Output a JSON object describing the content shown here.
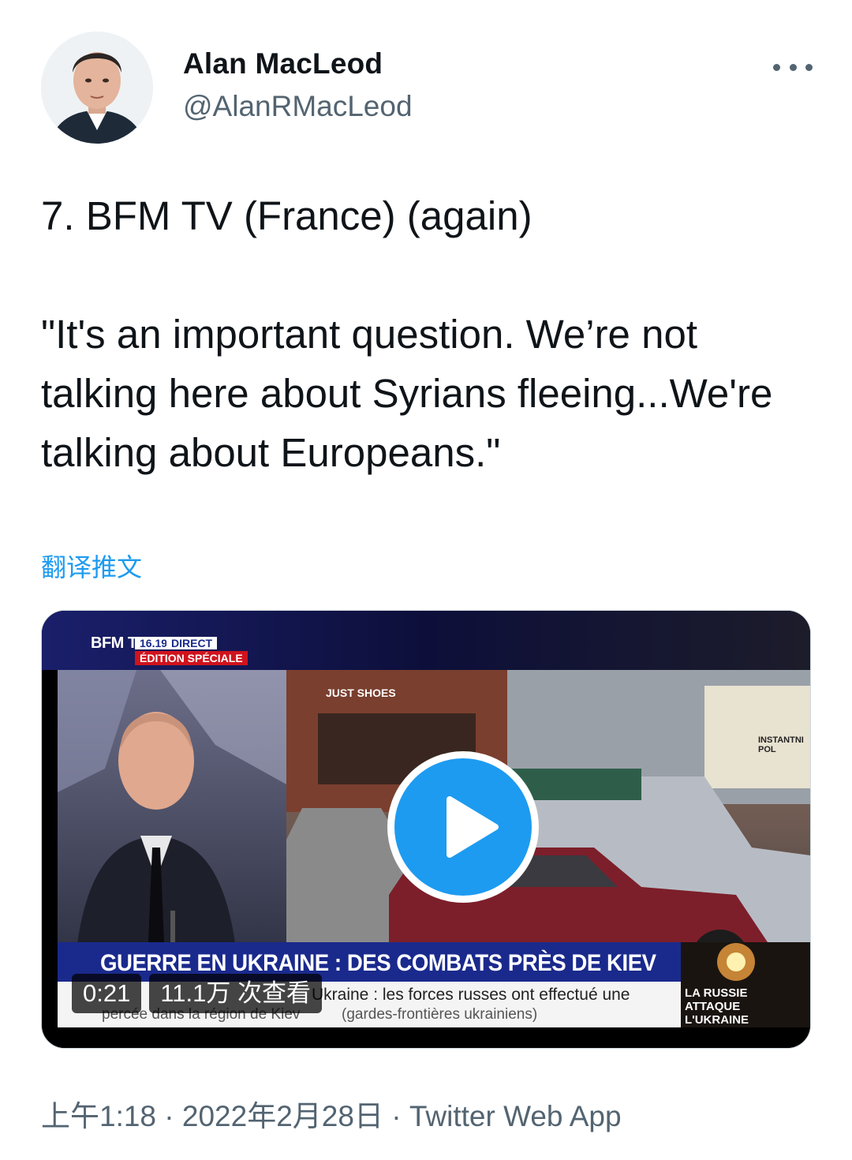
{
  "author": {
    "name": "Alan MacLeod",
    "handle": "@AlanRMacLeod",
    "avatar_icon": "person-avatar-icon"
  },
  "menu": {
    "icon": "more-horizontal-icon"
  },
  "tweet": {
    "lines": [
      "7. BFM TV (France) (again)",
      "\"It's an important question. We’re not talking here about Syrians fleeing...We're talking about Europeans.\""
    ],
    "translate_label": "翻译推文"
  },
  "media": {
    "duration": "0:21",
    "views": "11.1万 次查看",
    "play_icon": "play-icon",
    "screen": {
      "logo": "BFM TV.",
      "time": "16.19",
      "direct": "DIRECT",
      "special": "ÉDITION SPÉCIALE",
      "sign": "JUST SHOES",
      "side_sign": "INSTANTNI POL",
      "ticker_title": "GUERRE EN UKRAINE : DES COMBATS PRÈS DE KIEV",
      "ticker_line1": "Ukraine : les forces russes ont effectué une",
      "ticker_line2_left": "percée dans la région de Kiev",
      "ticker_line2_right": "(gardes-frontières ukrainiens)",
      "side_label": "LA RUSSIE ATTAQUE L'UKRAINE"
    }
  },
  "meta": {
    "time": "上午1:18",
    "date": "2022年2月28日",
    "source": "Twitter Web App",
    "separator": " · "
  },
  "colors": {
    "text": "#0f1419",
    "secondary": "#536471",
    "link": "#1d9bf0",
    "bfm_blue": "#1a2a8c",
    "bfm_red": "#d0131c"
  }
}
